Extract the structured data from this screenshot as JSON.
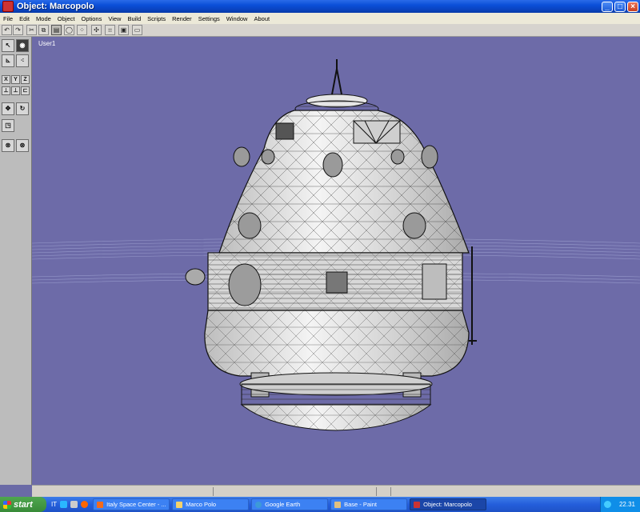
{
  "window": {
    "title": "Object: Marcopolo"
  },
  "menu": [
    "File",
    "Edit",
    "Mode",
    "Object",
    "Options",
    "View",
    "Build",
    "Scripts",
    "Render",
    "Settings",
    "Window",
    "About"
  ],
  "sidebar": {
    "axes": [
      "X",
      "Y",
      "Z"
    ]
  },
  "viewport": {
    "label": "User1",
    "background": "#6d6ba8"
  },
  "taskbar": {
    "start_label": "start",
    "language": "IT",
    "tasks": [
      {
        "label": "Italy Space Center - ...",
        "icon": "browser-icon",
        "color": "#f26b1d"
      },
      {
        "label": "Marco Polo",
        "icon": "folder-icon",
        "color": "#f5d26b"
      },
      {
        "label": "Google Earth",
        "icon": "globe-icon",
        "color": "#3d9ad8"
      },
      {
        "label": "Base - Paint",
        "icon": "paint-icon",
        "color": "#e0c080"
      },
      {
        "label": "Object: Marcopolo",
        "icon": "app-icon",
        "color": "#c33",
        "active": true
      }
    ],
    "clock": "22.31"
  }
}
